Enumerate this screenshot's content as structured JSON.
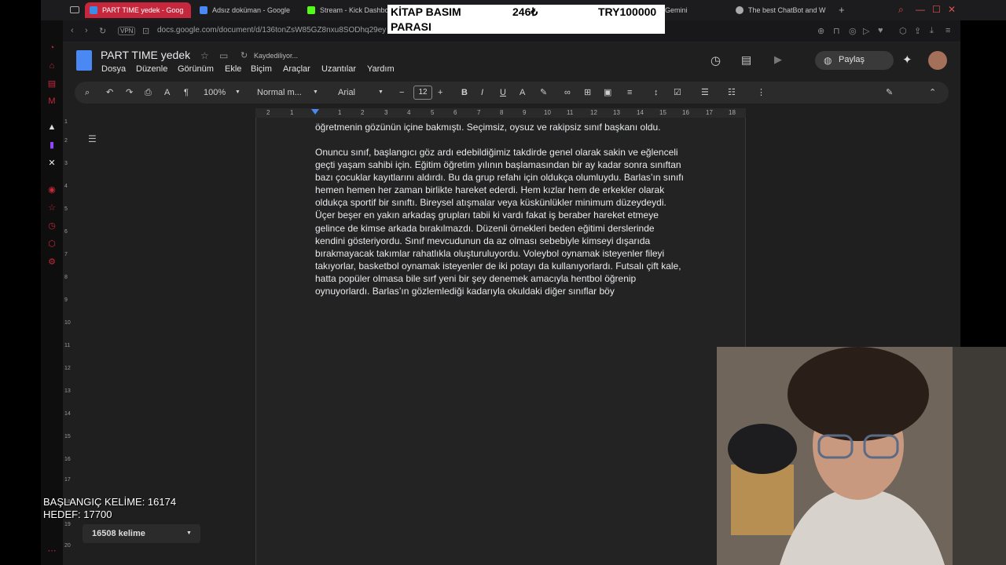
{
  "browser": {
    "tabs": [
      {
        "label": "PART TIME yedek - Goog",
        "active": true,
        "color": "#3c8de8"
      },
      {
        "label": "Adsız doküman - Google",
        "active": false,
        "color": "#4a89f3"
      },
      {
        "label": "Stream - Kick Dashbo",
        "active": false,
        "color": "#53fc18"
      },
      {
        "label": "Gemini",
        "active": false,
        "color": "#888"
      },
      {
        "label": "The best ChatBot and W",
        "active": false,
        "color": "#aaa"
      }
    ],
    "new_tab": "+",
    "vpn": "VPN",
    "url": "docs.google.com/document/d/136tonZsW85GZ8nxu8SODhq29ey"
  },
  "banner": {
    "line1_label": "KİTAP BASIM",
    "line1_value": "246₺",
    "line1_total": "TRY100000",
    "line2": "PARASI"
  },
  "docs": {
    "title": "PART TIME yedek",
    "saving_status": "Kaydediliyor...",
    "menu": [
      "Dosya",
      "Düzenle",
      "Görünüm",
      "Ekle",
      "Biçim",
      "Araçlar",
      "Uzantılar",
      "Yardım"
    ],
    "share_label": "Paylaş",
    "zoom": "100%",
    "style": "Normal m...",
    "font": "Arial",
    "font_size": "12",
    "ruler_numbers": [
      "2",
      "1",
      "1",
      "2",
      "3",
      "4",
      "5",
      "6",
      "7",
      "8",
      "9",
      "10",
      "11",
      "12",
      "13",
      "14",
      "15",
      "16",
      "17",
      "18"
    ],
    "vruler_numbers": [
      "1",
      "2",
      "3",
      "4",
      "5",
      "6",
      "7",
      "8",
      "9",
      "10",
      "11",
      "12",
      "13",
      "14",
      "15",
      "16",
      "17",
      "18",
      "19",
      "20"
    ],
    "para_top": "öğretmenin gözünün içine bakmıştı. Seçimsiz, oysuz ve rakipsiz sınıf başkanı oldu.",
    "para_main": "Onuncu sınıf, başlangıcı göz ardı edebildiğimiz takdirde genel olarak sakin ve eğlenceli geçti yaşam sahibi için. Eğitim öğretim yılının başlamasından bir ay kadar sonra sınıftan bazı çocuklar kayıtlarını aldırdı. Bu da grup refahı için oldukça olumluydu. Barlas’ın sınıfı hemen hemen her zaman birlikte hareket ederdi. Hem kızlar hem de erkekler olarak oldukça sportif bir sınıftı. Bireysel atışmalar veya küskünlükler minimum düzeydeydi. Üçer beşer en yakın arkadaş grupları tabii ki vardı fakat iş beraber hareket etmeye gelince de kimse arkada bırakılmazdı. Düzenli örnekleri beden eğitimi derslerinde kendini gösteriyordu. Sınıf mevcudunun da az olması sebebiyle kimseyi dışarıda bırakmayacak takımlar rahatlıkla oluşturuluyordu. Voleybol oynamak isteyenler fileyi takıyorlar, basketbol oynamak isteyenler de iki potayı da kullanıyorlardı. Futsalı çift kale, hatta popüler olmasa bile sırf yeni bir şey denemek amacıyla hentbol öğrenip oynuyorlardı. Barlas’ın gözlemlediği kadarıyla okuldaki diğer sınıflar böy",
    "word_count": "16508 kelime"
  },
  "overlay": {
    "start_words": "BAŞLANGIÇ KELİME: 16174",
    "target": "HEDEF: 17700"
  }
}
